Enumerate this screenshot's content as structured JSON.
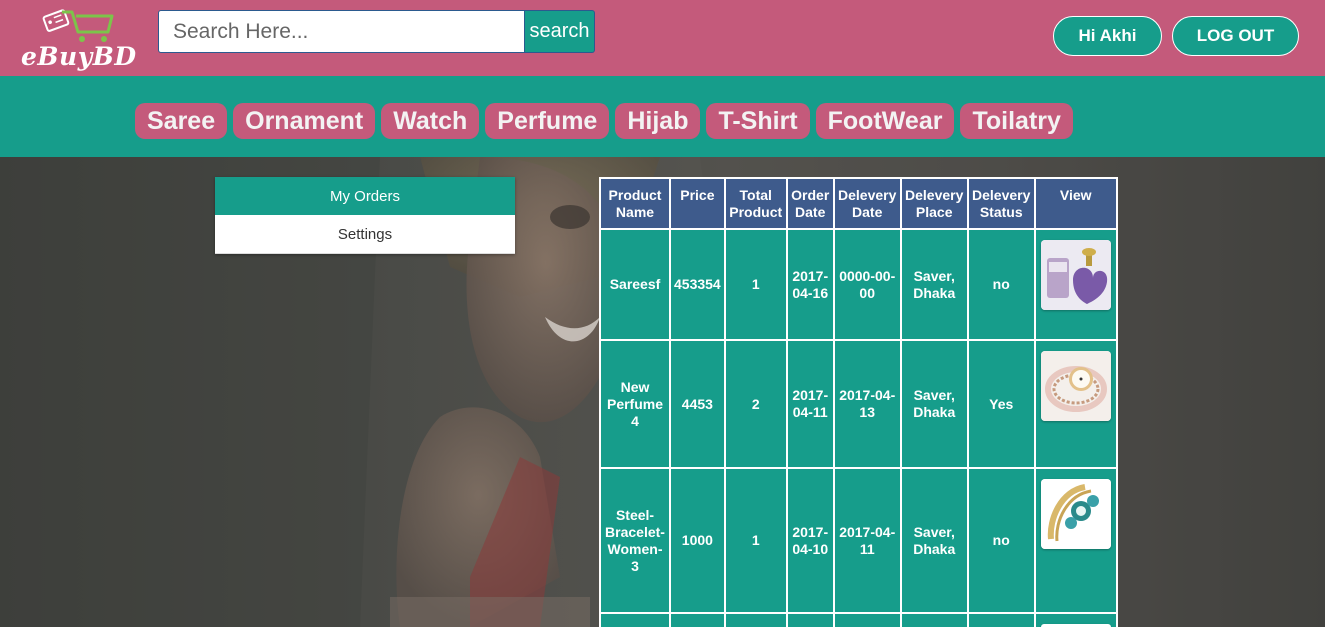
{
  "brand": {
    "name": "eBuyBD"
  },
  "search": {
    "placeholder": "Search Here...",
    "button_label": "search"
  },
  "user": {
    "greeting": "Hi Akhi",
    "logout_label": "LOG OUT"
  },
  "categories": [
    "Saree",
    "Ornament",
    "Watch",
    "Perfume",
    "Hijab",
    "T-Shirt",
    "FootWear",
    "Toilatry"
  ],
  "side_menu": {
    "items": [
      {
        "label": "My Orders",
        "active": true
      },
      {
        "label": "Settings",
        "active": false
      }
    ]
  },
  "orders": {
    "columns": [
      "Product Name",
      "Price",
      "Total Product",
      "Order Date",
      "Delevery Date",
      "Delevery Place",
      "Delevery Status",
      "View"
    ],
    "rows": [
      {
        "product": "Sareesf",
        "price": "453354",
        "total": "1",
        "order_date": "2017-04-16",
        "delivery_date": "0000-00-00",
        "place": "Saver, Dhaka",
        "status": "no",
        "image": "perfume-bottle-image"
      },
      {
        "product": "New Perfume 4",
        "price": "4453",
        "total": "2",
        "order_date": "2017-04-11",
        "delivery_date": "2017-04-13",
        "place": "Saver, Dhaka",
        "status": "Yes",
        "image": "bracelet-watch-image"
      },
      {
        "product": "Steel-Bracelet-Women-3",
        "price": "1000",
        "total": "1",
        "order_date": "2017-04-10",
        "delivery_date": "2017-04-11",
        "place": "Saver, Dhaka",
        "status": "no",
        "image": "gem-bracelet-image"
      }
    ]
  },
  "colors": {
    "header": "#c45a7b",
    "accent": "#169d8b",
    "table_header": "#3e5b8c"
  }
}
